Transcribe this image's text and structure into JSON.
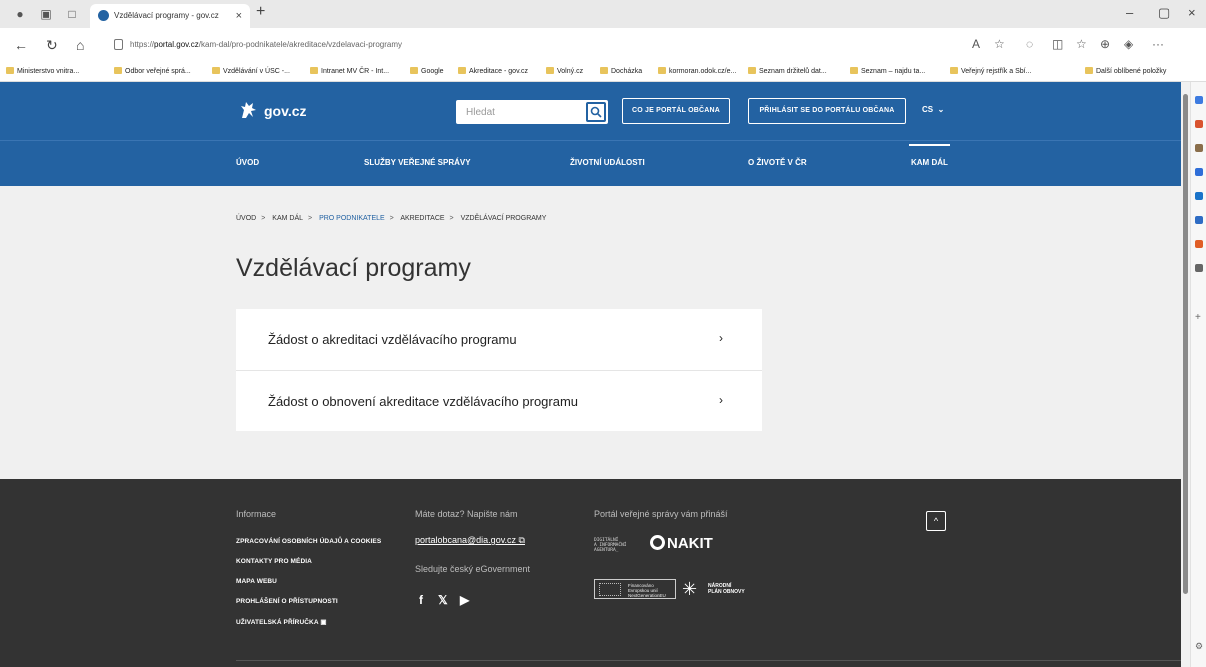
{
  "browser": {
    "tab_title": "Vzdělávací programy - gov.cz",
    "url_prefix": "https://",
    "url_host": "portal.gov.cz",
    "url_path": "/kam-dal/pro-podnikatele/akreditace/vzdelavaci-programy",
    "bookmarks": [
      "Ministerstvo vnitra...",
      "Odbor veřejné sprá...",
      "Vzdělávání v ÚSC -...",
      "Intranet MV ČR - Int...",
      "Google",
      "Akreditace - gov.cz",
      "Volný.cz",
      "Docházka",
      "kormoran.odok.cz/e...",
      "Seznam držitelů dat...",
      "Seznam – najdu ta...",
      "Veřejný rejstřík a Sbí...",
      "Další oblíbené položky"
    ]
  },
  "header": {
    "logo_text": "gov.cz",
    "search_placeholder": "Hledat",
    "btn_co_je": "CO JE PORTÁL OBČANA",
    "btn_login": "PŘIHLÁSIT SE DO PORTÁLU OBČANA",
    "lang": "CS"
  },
  "nav": {
    "items": [
      "ÚVOD",
      "SLUŽBY VEŘEJNÉ SPRÁVY",
      "ŽIVOTNÍ UDÁLOSTI",
      "O ŽIVOTĚ V ČR",
      "KAM DÁL"
    ],
    "active": "KAM DÁL"
  },
  "breadcrumb": [
    "ÚVOD",
    "KAM DÁL",
    "PRO PODNIKATELE",
    "AKREDITACE",
    "VZDĚLÁVACÍ PROGRAMY"
  ],
  "breadcrumb_sep": ">",
  "page_title": "Vzdělávací programy",
  "cards": [
    "Žádost o akreditaci vzdělávacího programu",
    "Žádost o obnovení akreditace vzdělávacího programu"
  ],
  "card_arrow": "›",
  "footer": {
    "info_heading": "Informace",
    "links": [
      "ZPRACOVÁNÍ OSOBNÍCH ÚDAJŮ A COOKIES",
      "KONTAKTY PRO MÉDIA",
      "MAPA WEBU",
      "PROHLÁŠENÍ O PŘÍSTUPNOSTI",
      "UŽIVATELSKÁ PŘÍRUČKA"
    ],
    "contact_heading": "Máte dotaz? Napište nám",
    "email": "portalobcana@dia.gov.cz",
    "follow_heading": "Sledujte český eGovernment",
    "social": [
      "f",
      "𝕏",
      "▶"
    ],
    "brought_heading": "Portál veřejné správy vám přináší",
    "agency_lines": [
      "DIGITÁLNÍ",
      "A INFORMAČNÍ",
      "AGENTURA_"
    ],
    "nakit": "NAKIT",
    "eu_lines": [
      "Financováno",
      "Evropskou unií",
      "NextGenerationEU"
    ],
    "npo_lines": [
      "NÁRODNÍ",
      "PLÁN OBNOVY"
    ],
    "up_label": "^"
  }
}
